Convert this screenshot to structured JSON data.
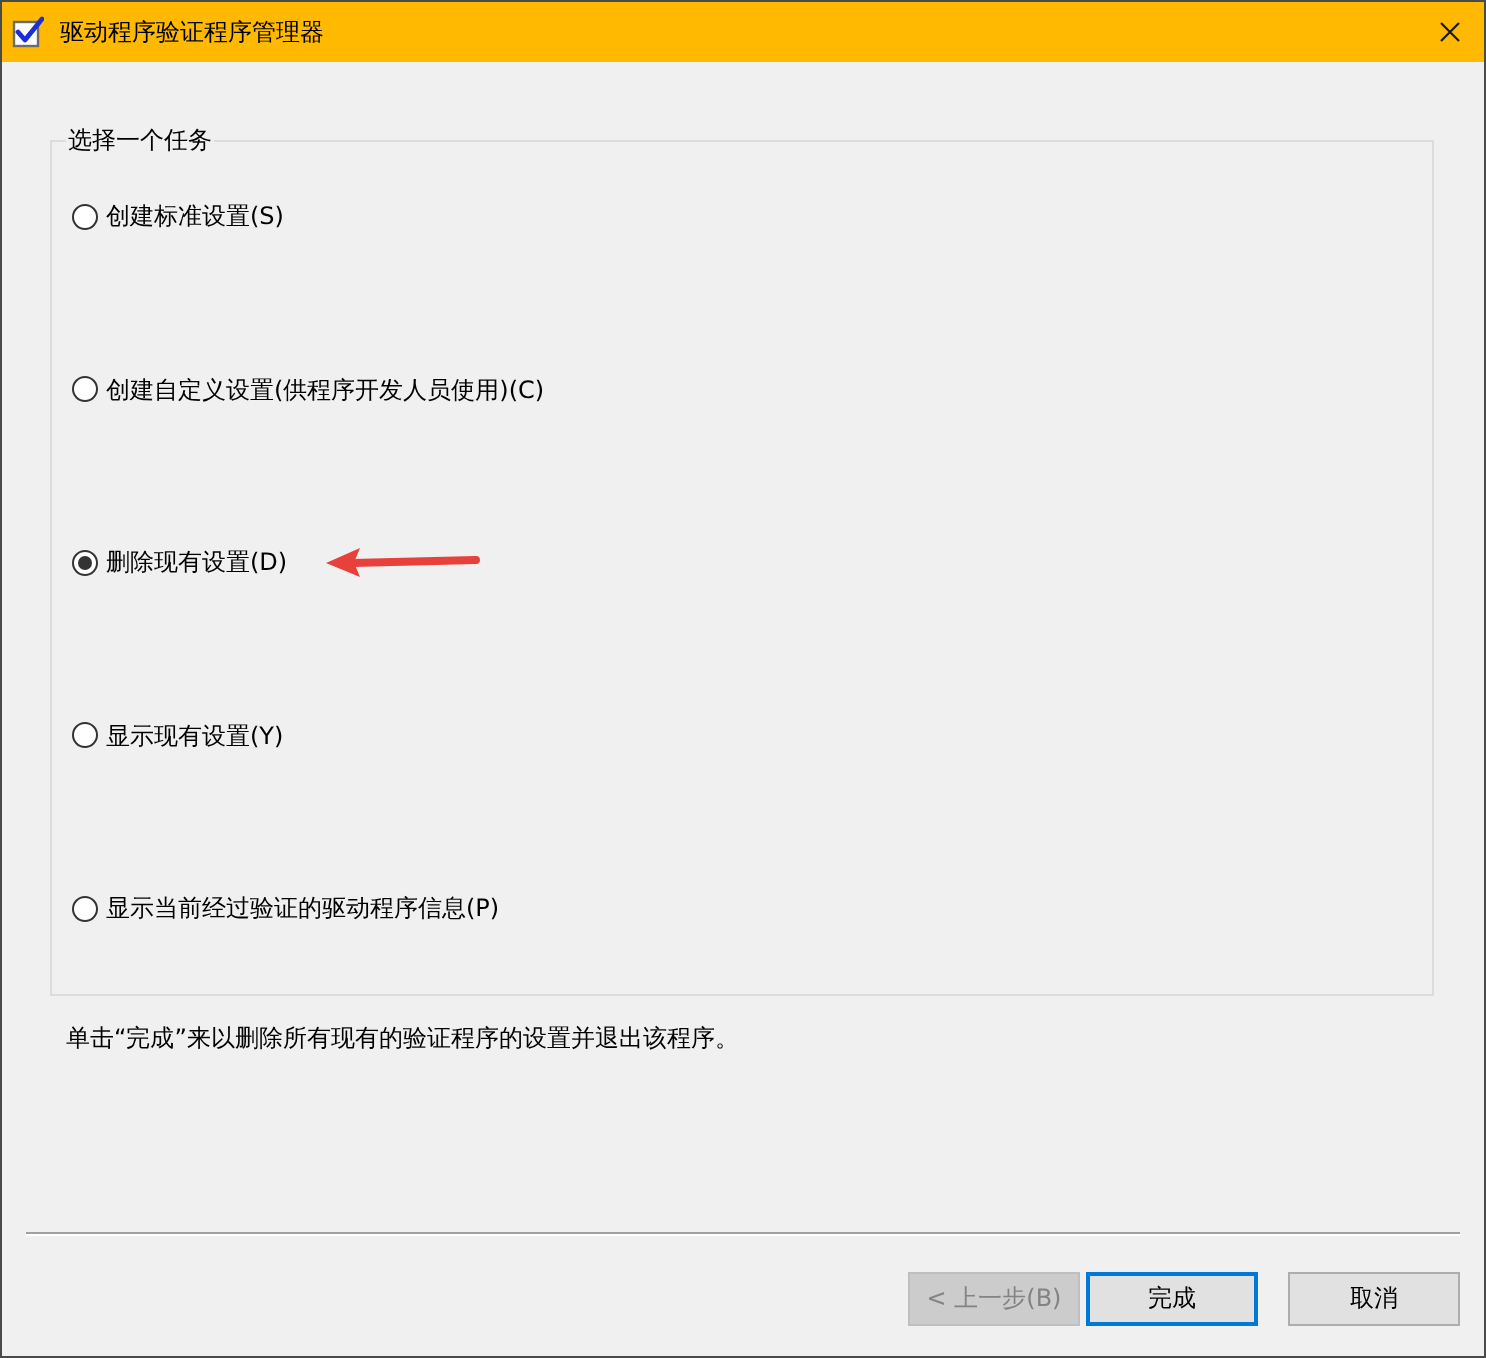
{
  "window": {
    "title": "驱动程序验证程序管理器"
  },
  "task_group": {
    "label": "选择一个任务",
    "options": [
      {
        "label": "创建标准设置(S)",
        "selected": false,
        "arrow": false
      },
      {
        "label": "创建自定义设置(供程序开发人员使用)(C)",
        "selected": false,
        "arrow": false
      },
      {
        "label": "删除现有设置(D)",
        "selected": true,
        "arrow": true
      },
      {
        "label": "显示现有设置(Y)",
        "selected": false,
        "arrow": false
      },
      {
        "label": "显示当前经过验证的驱动程序信息(P)",
        "selected": false,
        "arrow": false
      }
    ]
  },
  "description": "单击“完成”来以删除所有现有的验证程序的设置并退出该程序。",
  "buttons": [
    {
      "label": "< 上一步(B)",
      "disabled": true,
      "default": false
    },
    {
      "label": "完成",
      "disabled": false,
      "default": true
    },
    {
      "label": "取消",
      "disabled": false,
      "default": false
    }
  ]
}
